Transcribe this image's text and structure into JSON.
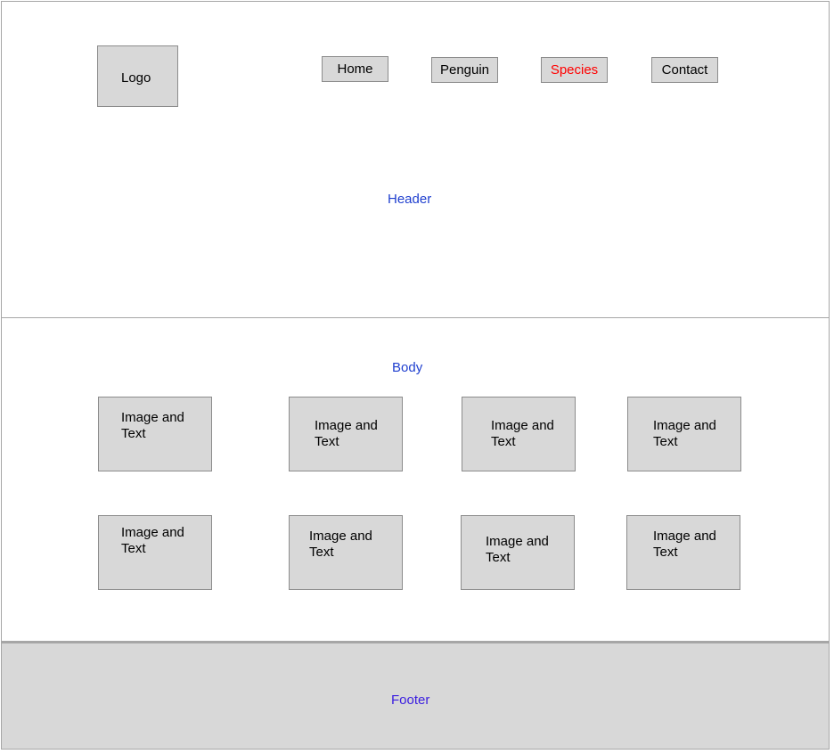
{
  "header": {
    "label": "Header",
    "logo": "Logo",
    "nav": [
      {
        "label": "Home",
        "active": false
      },
      {
        "label": "Penguin",
        "active": false
      },
      {
        "label": "Species",
        "active": true
      },
      {
        "label": "Contact",
        "active": false
      }
    ]
  },
  "body": {
    "label": "Body",
    "cards": [
      {
        "text": "Image and Text"
      },
      {
        "text": "Image and Text"
      },
      {
        "text": "Image and Text"
      },
      {
        "text": "Image and Text"
      },
      {
        "text": "Image and Text"
      },
      {
        "text": "Image and Text"
      },
      {
        "text": "Image and Text"
      },
      {
        "text": "Image and Text"
      }
    ]
  },
  "footer": {
    "label": "Footer"
  },
  "colors": {
    "section_label": "#1f3fcf",
    "active_nav": "#ff0000",
    "box_fill": "#d8d8d8",
    "footer_fill": "#d8d8d8"
  }
}
